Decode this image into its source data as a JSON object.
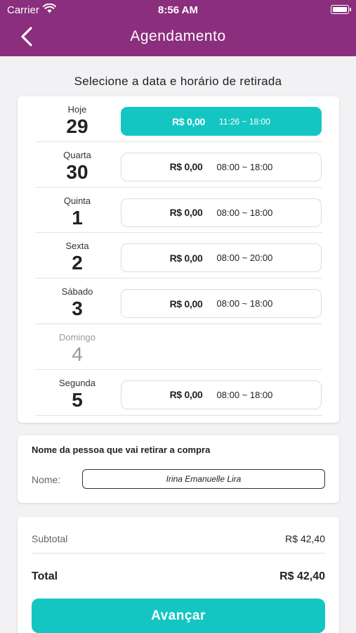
{
  "status_bar": {
    "carrier": "Carrier",
    "time": "8:56 AM"
  },
  "nav": {
    "title": "Agendamento"
  },
  "schedule": {
    "title": "Selecione a data e horário de retirada",
    "days": [
      {
        "name": "Hoje",
        "number": "29",
        "price": "R$ 0,00",
        "hours": "11:26 ~ 18:00",
        "selected": true,
        "available": true
      },
      {
        "name": "Quarta",
        "number": "30",
        "price": "R$ 0,00",
        "hours": "08:00 ~ 18:00",
        "selected": false,
        "available": true
      },
      {
        "name": "Quinta",
        "number": "1",
        "price": "R$ 0,00",
        "hours": "08:00 ~ 18:00",
        "selected": false,
        "available": true
      },
      {
        "name": "Sexta",
        "number": "2",
        "price": "R$ 0,00",
        "hours": "08:00 ~ 20:00",
        "selected": false,
        "available": true
      },
      {
        "name": "Sábado",
        "number": "3",
        "price": "R$ 0,00",
        "hours": "08:00 ~ 18:00",
        "selected": false,
        "available": true
      },
      {
        "name": "Domingo",
        "number": "4",
        "available": false
      },
      {
        "name": "Segunda",
        "number": "5",
        "price": "R$ 0,00",
        "hours": "08:00 ~ 18:00",
        "selected": false,
        "available": true
      }
    ]
  },
  "pickup": {
    "title": "Nome da pessoa que vai retirar a compra",
    "label": "Nome:",
    "value": "Irina Emanuelle Lira"
  },
  "summary": {
    "subtotal_label": "Subtotal",
    "subtotal_value": "R$ 42,40",
    "total_label": "Total",
    "total_value": "R$ 42,40",
    "button_label": "Avançar"
  },
  "colors": {
    "header": "#8a2e7d",
    "accent": "#14c6c2",
    "background": "#f2f2f4"
  },
  "icons": [
    "wifi-icon",
    "battery-icon",
    "back-arrow-icon"
  ]
}
